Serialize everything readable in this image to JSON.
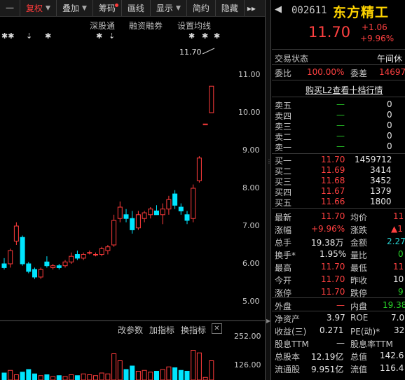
{
  "toolbar": {
    "dash": "一",
    "fuquan": "复权",
    "diejia": "叠加",
    "chouma": "筹码",
    "huaxian": "画线",
    "xianshi": "显示",
    "jianyue": "简约",
    "yincang": "隐藏",
    "more": "▸▸"
  },
  "chart": {
    "links": {
      "shengutong": "深股通",
      "rongzi": "融资融券",
      "junxian": "设置均线"
    },
    "markers": [
      "✱✱",
      "⇣",
      "✱",
      "✱",
      "⇣",
      "✱",
      "✱",
      "✱"
    ],
    "y_labels": [
      "11.00",
      "10.00",
      "9.00",
      "8.00",
      "7.00",
      "6.00",
      "5.00"
    ],
    "price_note": "11.70",
    "volume": {
      "gai_canshu": "改参数",
      "jia_zhibiao": "加指标",
      "huan_zhibiao": "换指标",
      "close": "✕",
      "y_labels": [
        "252.00",
        "126.00"
      ]
    }
  },
  "chart_data": {
    "type": "candlestick",
    "ylim": [
      4.8,
      11.7
    ],
    "candles": [
      {
        "o": 6.0,
        "h": 6.15,
        "l": 5.85,
        "c": 5.9
      },
      {
        "o": 6.0,
        "h": 6.4,
        "l": 5.9,
        "c": 6.35
      },
      {
        "o": 6.6,
        "h": 7.1,
        "l": 6.5,
        "c": 7.0
      },
      {
        "o": 6.7,
        "h": 6.75,
        "l": 5.95,
        "c": 6.0
      },
      {
        "o": 6.0,
        "h": 6.05,
        "l": 5.75,
        "c": 5.8
      },
      {
        "o": 5.85,
        "h": 5.9,
        "l": 5.6,
        "c": 5.65
      },
      {
        "o": 5.65,
        "h": 5.9,
        "l": 5.6,
        "c": 5.85
      },
      {
        "o": 6.05,
        "h": 6.2,
        "l": 5.9,
        "c": 5.95
      },
      {
        "o": 5.9,
        "h": 6.0,
        "l": 5.85,
        "c": 5.95
      },
      {
        "o": 5.95,
        "h": 6.0,
        "l": 5.85,
        "c": 5.9
      },
      {
        "o": 5.95,
        "h": 6.1,
        "l": 5.9,
        "c": 6.05
      },
      {
        "o": 6.05,
        "h": 6.3,
        "l": 6.0,
        "c": 6.2
      },
      {
        "o": 6.25,
        "h": 6.35,
        "l": 6.1,
        "c": 6.15
      },
      {
        "o": 6.15,
        "h": 6.3,
        "l": 6.1,
        "c": 6.25
      },
      {
        "o": 6.3,
        "h": 6.35,
        "l": 6.25,
        "c": 6.3
      },
      {
        "o": 6.25,
        "h": 6.3,
        "l": 6.2,
        "c": 6.25
      },
      {
        "o": 6.25,
        "h": 6.45,
        "l": 6.2,
        "c": 6.4
      },
      {
        "o": 6.35,
        "h": 6.5,
        "l": 6.25,
        "c": 6.45
      },
      {
        "o": 6.5,
        "h": 7.3,
        "l": 6.45,
        "c": 7.15
      },
      {
        "o": 7.2,
        "h": 7.65,
        "l": 7.1,
        "c": 7.5
      },
      {
        "o": 7.3,
        "h": 7.45,
        "l": 7.1,
        "c": 7.2
      },
      {
        "o": 7.2,
        "h": 7.4,
        "l": 6.8,
        "c": 6.9
      },
      {
        "o": 6.95,
        "h": 7.4,
        "l": 6.9,
        "c": 7.3
      },
      {
        "o": 7.2,
        "h": 7.4,
        "l": 7.1,
        "c": 7.35
      },
      {
        "o": 7.3,
        "h": 7.5,
        "l": 7.2,
        "c": 7.45
      },
      {
        "o": 7.4,
        "h": 7.55,
        "l": 7.3,
        "c": 7.3
      },
      {
        "o": 7.3,
        "h": 7.6,
        "l": 7.05,
        "c": 7.45
      },
      {
        "o": 7.45,
        "h": 7.8,
        "l": 7.3,
        "c": 7.7
      },
      {
        "o": 7.85,
        "h": 7.95,
        "l": 7.45,
        "c": 7.55
      },
      {
        "o": 7.5,
        "h": 7.6,
        "l": 7.3,
        "c": 7.4
      },
      {
        "o": 7.3,
        "h": 7.4,
        "l": 7.05,
        "c": 7.15
      },
      {
        "o": 7.2,
        "h": 8.1,
        "l": 7.1,
        "c": 8.0
      },
      {
        "o": 8.2,
        "h": 8.85,
        "l": 8.15,
        "c": 8.8
      },
      {
        "o": 9.7,
        "h": 9.7,
        "l": 9.7,
        "c": 9.7
      },
      {
        "o": 10.0,
        "h": 10.7,
        "l": 10.0,
        "c": 10.7
      }
    ],
    "volume": [
      40,
      55,
      30,
      45,
      60,
      35,
      25,
      30,
      20,
      25,
      20,
      30,
      25,
      35,
      30,
      25,
      40,
      35,
      150,
      110,
      60,
      80,
      50,
      55,
      45,
      50,
      60,
      75,
      70,
      55,
      50,
      170,
      155,
      15,
      110
    ],
    "volume_ylim": [
      0,
      270
    ]
  },
  "quote": {
    "code": "002611",
    "name": "东方精工",
    "last": "11.70",
    "change": "+1.06",
    "change_pct": "+9.96%",
    "status_label": "交易状态",
    "status_value": "午间休",
    "weibi_label": "委比",
    "weibi_value": "100.00%",
    "weicha_label": "委差",
    "weicha_value": "14697",
    "l2_link": "购买L2查看十档行情",
    "asks": [
      {
        "label": "卖五",
        "price": "—",
        "vol": "0"
      },
      {
        "label": "卖四",
        "price": "—",
        "vol": "0"
      },
      {
        "label": "卖三",
        "price": "—",
        "vol": "0"
      },
      {
        "label": "卖二",
        "price": "—",
        "vol": "0"
      },
      {
        "label": "卖一",
        "price": "—",
        "vol": "0"
      }
    ],
    "bids": [
      {
        "label": "买一",
        "price": "11.70",
        "vol": "1459712"
      },
      {
        "label": "买二",
        "price": "11.69",
        "vol": "3414"
      },
      {
        "label": "买三",
        "price": "11.68",
        "vol": "3452"
      },
      {
        "label": "买四",
        "price": "11.67",
        "vol": "1379"
      },
      {
        "label": "买五",
        "price": "11.66",
        "vol": "1800"
      }
    ],
    "stats": {
      "latest_label": "最新",
      "latest": "11.70",
      "avg_label": "均价",
      "avg": "11",
      "zhangfu_label": "涨幅",
      "zhangfu": "+9.96%",
      "zhangdie_label": "涨跌",
      "zhangdie": "▲1",
      "zongshou_label": "总手",
      "zongshou": "19.38万",
      "jine_label": "金额",
      "jine": "2.27",
      "huanshou_label": "换手*",
      "huanshou": "1.95%",
      "liangbi_label": "量比",
      "liangbi": "0",
      "high_label": "最高",
      "high": "11.70",
      "low_label": "最低",
      "low": "11",
      "open_label": "今开",
      "open": "11.70",
      "prev_label": "昨收",
      "prev": "10",
      "zhangting_label": "涨停",
      "zhangting": "11.70",
      "dieting_label": "跌停",
      "dieting": "9",
      "waipan_label": "外盘",
      "waipan": "—",
      "neipan_label": "内盘",
      "neipan": "19.38",
      "jingzichan_label": "净资产",
      "jingzichan": "3.97",
      "roe_label": "ROE",
      "roe": "7.0",
      "shouyi_label": "收益(三)",
      "shouyi": "0.271",
      "pe_label": "PE(动)*",
      "pe": "32",
      "guxi_label": "股息TTM",
      "guxi": "—",
      "guxilv_label": "股息率TTM",
      "guxilv": "",
      "zongguben_label": "总股本",
      "zongguben": "12.19亿",
      "zongzhi_label": "总值",
      "zongzhi": "142.6",
      "liutonggu_label": "流通股",
      "liutonggu": "9.951亿",
      "liuzhi_label": "流值",
      "liuzhi": "116.4"
    }
  }
}
